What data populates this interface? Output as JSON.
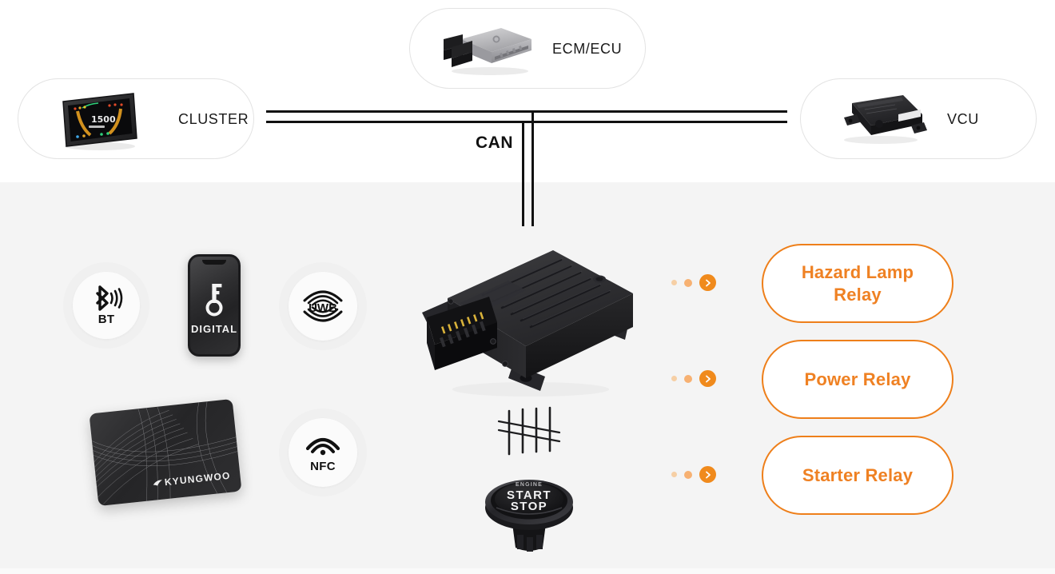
{
  "theme": {
    "accent": "#ef8123",
    "accent_dark": "#ee7f1a",
    "bg_top": "#ffffff",
    "bg_main": "#f4f4f4",
    "line": "#111111",
    "text": "#1a1a1a"
  },
  "bus": {
    "label": "CAN"
  },
  "nodes": [
    {
      "id": "cluster",
      "label": "CLUSTER",
      "icon": "instrument-cluster-display"
    },
    {
      "id": "ecm-ecu",
      "label": "ECM/ECU",
      "icon": "ecu-module-silver"
    },
    {
      "id": "vcu",
      "label": "VCU",
      "icon": "vcu-module-black"
    }
  ],
  "inputs": [
    {
      "id": "bt",
      "label": "BT",
      "icon": "bluetooth-icon"
    },
    {
      "id": "digital-key",
      "label": "DIGITAL",
      "icon": "key-icon",
      "device": "smartphone"
    },
    {
      "id": "uwb",
      "label": "UWB",
      "icon": "uwb-waves-icon"
    },
    {
      "id": "nfc-card",
      "label": "KYUNGWOO",
      "icon": "smart-card"
    },
    {
      "id": "nfc",
      "label": "NFC",
      "icon": "nfc-waves-icon"
    }
  ],
  "center_module": {
    "name": "smart-key-control-module",
    "harness": "wire-harness"
  },
  "start_button": {
    "top_label": "ENGINE",
    "line1": "START",
    "line2": "STOP"
  },
  "outputs": [
    {
      "id": "hazard-lamp-relay",
      "label": "Hazard Lamp Relay",
      "line1": "Hazard Lamp",
      "line2": "Relay"
    },
    {
      "id": "power-relay",
      "label": "Power Relay",
      "line1": "Power Relay",
      "line2": ""
    },
    {
      "id": "starter-relay",
      "label": "Starter Relay",
      "line1": "Starter Relay",
      "line2": ""
    }
  ],
  "connector": {
    "dot_faint_color": "#f6cfa5",
    "dot_mid_color": "#f7b172",
    "arrow_color": "#f08a1c",
    "arrow_glyph": "›"
  }
}
